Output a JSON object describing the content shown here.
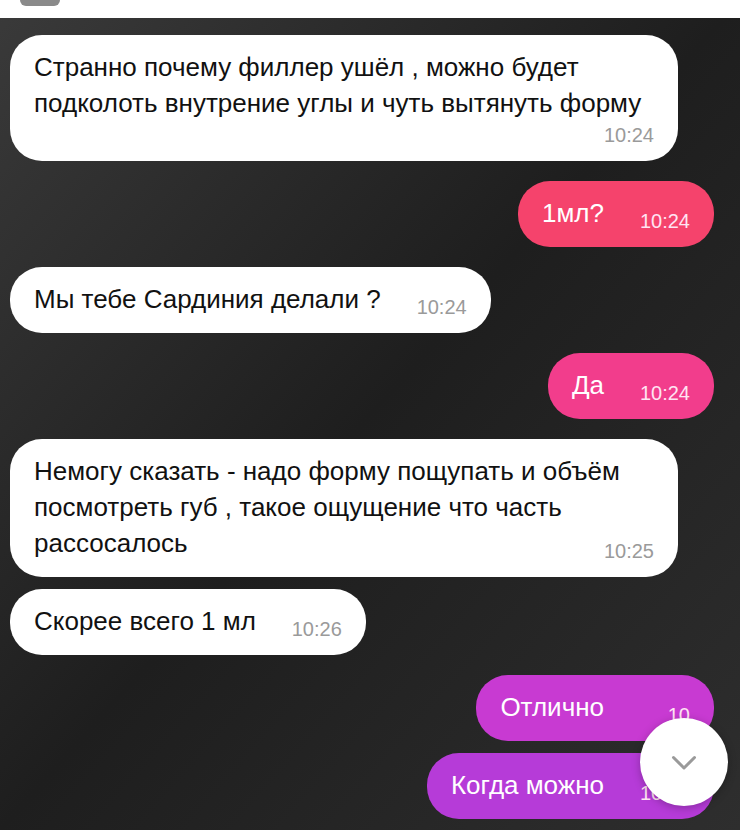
{
  "messages": [
    {
      "kind": "incoming",
      "text": "Странно почему филлер ушёл , можно будет подколоть внутрение углы и чуть вытянуть форму",
      "time": "10:24",
      "color": "#ffffff"
    },
    {
      "kind": "outgoing",
      "text": "1мл?",
      "time": "10:24",
      "color": "#f5436c"
    },
    {
      "kind": "incoming",
      "text": "Мы тебе Сардиния делали ?",
      "time": "10:24",
      "color": "#ffffff"
    },
    {
      "kind": "outgoing",
      "text": "Да",
      "time": "10:24",
      "color": "#f23d8c"
    },
    {
      "kind": "incoming",
      "text": "Немогу сказать - надо форму пощупать и объём посмотреть губ , такое ощущение что часть рассосалось",
      "time": "10:25",
      "color": "#ffffff"
    },
    {
      "kind": "incoming",
      "text": "Скорее всего 1 мл",
      "time": "10:26",
      "color": "#ffffff"
    },
    {
      "kind": "outgoing",
      "text": "Отлично",
      "time": "10",
      "color": "#c83ad2"
    },
    {
      "kind": "outgoing",
      "text": "Когда можно",
      "time": "10:28",
      "color": "#b63bd8"
    }
  ]
}
